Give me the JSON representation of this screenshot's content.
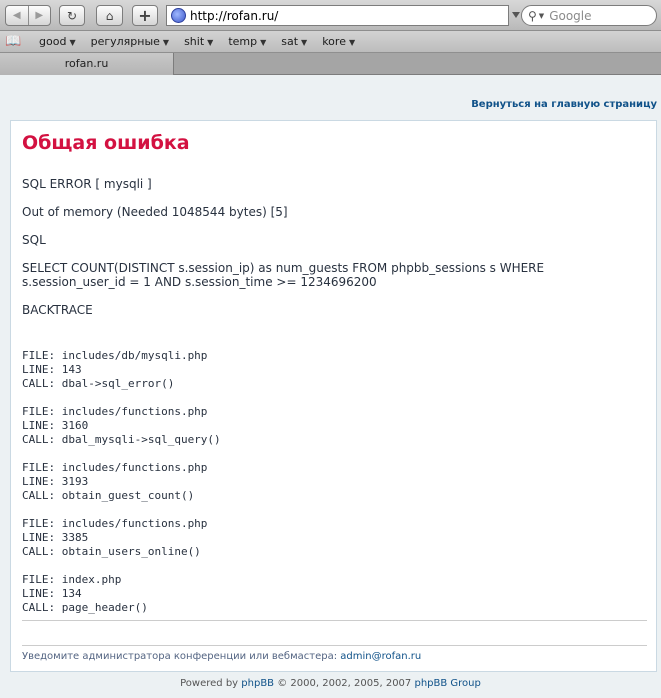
{
  "browser": {
    "url": "http://rofan.ru/",
    "search_placeholder": "Google",
    "tab_title": "rofan.ru",
    "bookmarks": [
      "good",
      "регулярные",
      "shit",
      "temp",
      "sat",
      "kore"
    ]
  },
  "page": {
    "return_link": "Вернуться на главную страницу",
    "title": "Общая ошибка",
    "lines": [
      "SQL ERROR [ mysqli ]",
      "Out of memory (Needed 1048544 bytes) [5]",
      "SQL",
      "SELECT COUNT(DISTINCT s.session_ip) as num_guests FROM phpbb_sessions s WHERE s.session_user_id = 1 AND s.session_time >= 1234696200",
      "BACKTRACE"
    ],
    "backtrace": [
      {
        "file": "FILE: includes/db/mysqli.php",
        "line": "LINE: 143",
        "call": "CALL: dbal->sql_error()"
      },
      {
        "file": "FILE: includes/functions.php",
        "line": "LINE: 3160",
        "call": "CALL: dbal_mysqli->sql_query()"
      },
      {
        "file": "FILE: includes/functions.php",
        "line": "LINE: 3193",
        "call": "CALL: obtain_guest_count()"
      },
      {
        "file": "FILE: includes/functions.php",
        "line": "LINE: 3385",
        "call": "CALL: obtain_users_online()"
      },
      {
        "file": "FILE: index.php",
        "line": "LINE: 134",
        "call": "CALL: page_header()"
      }
    ],
    "notify_text": "Уведомите администратора конференции или вебмастера:",
    "notify_email": "admin@rofan.ru",
    "footer_prefix": "Powered by",
    "footer_link1": "phpBB",
    "footer_mid": "© 2000, 2002, 2005, 2007",
    "footer_link2": "phpBB Group"
  },
  "colors": {
    "title": "#d31141",
    "link": "#105289",
    "background": "#ecf1f3"
  }
}
